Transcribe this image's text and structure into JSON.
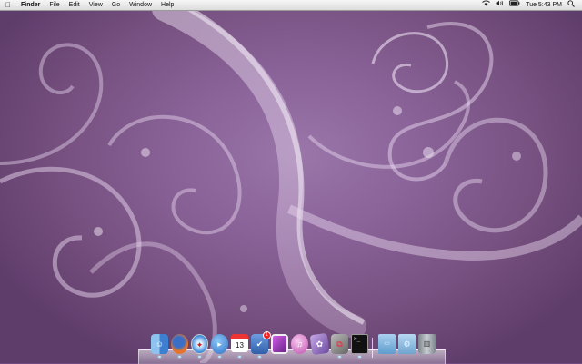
{
  "menubar": {
    "apple_icon": "apple-logo-icon",
    "app_name": "Finder",
    "menus": [
      "File",
      "Edit",
      "View",
      "Go",
      "Window",
      "Help"
    ],
    "status": {
      "wifi_icon": "wifi-icon",
      "volume_icon": "volume-icon",
      "battery_icon": "battery-icon",
      "clock": "Tue 5:43 PM",
      "spotlight_icon": "spotlight-search-icon"
    }
  },
  "dock": {
    "items": [
      {
        "name": "finder",
        "icon": "finder-icon",
        "color": "#4a90d9"
      },
      {
        "name": "firefox",
        "icon": "firefox-icon",
        "color": "#e8742a"
      },
      {
        "name": "safari",
        "icon": "safari-compass-icon",
        "color": "#3a8ad9"
      },
      {
        "name": "ichat",
        "icon": "ichat-video-icon",
        "color": "#3b86d6"
      },
      {
        "name": "ical",
        "icon": "calendar-icon",
        "day": "13"
      },
      {
        "name": "omnifocus",
        "icon": "checkmark-task-icon",
        "color": "#2e5fa8",
        "badge": "1"
      },
      {
        "name": "photo-app",
        "icon": "photo-frame-icon",
        "color": "#9b3fb5"
      },
      {
        "name": "itunes",
        "icon": "itunes-note-icon",
        "color": "#d86cc6"
      },
      {
        "name": "preview",
        "icon": "preview-photo-icon",
        "color": "#8a6ab8"
      },
      {
        "name": "vmware",
        "icon": "vmware-fusion-icon",
        "color": "#c0302a"
      },
      {
        "name": "terminal",
        "icon": "terminal-icon",
        "color": "#222222"
      },
      {
        "name": "documents-folder",
        "icon": "folder-icon",
        "color": "#6aa6d6"
      },
      {
        "name": "system-folder",
        "icon": "settings-folder-icon",
        "color": "#7fb3dc"
      },
      {
        "name": "trash",
        "icon": "trash-icon",
        "color": "#9aa1a8"
      }
    ]
  },
  "colors": {
    "wallpaper": "#7a5189",
    "swirl": "#e8d8ee",
    "menubar": "#e6e6e6"
  }
}
